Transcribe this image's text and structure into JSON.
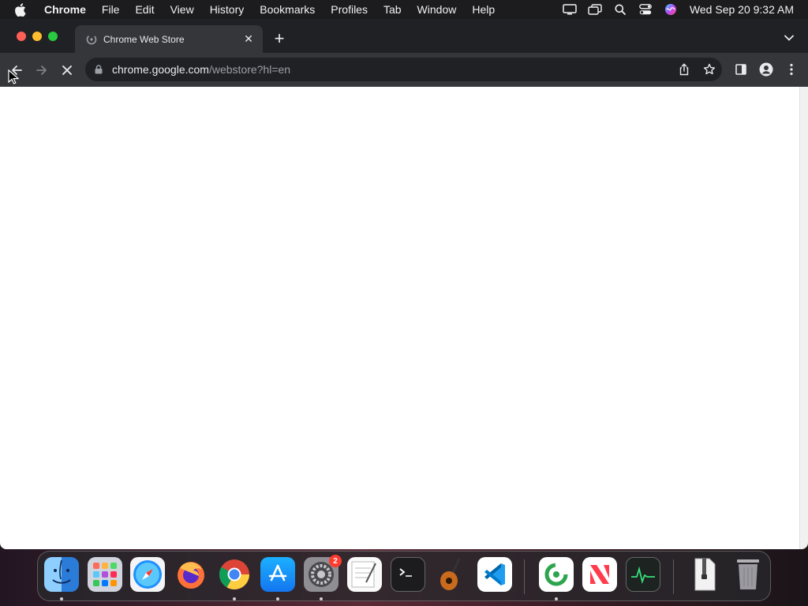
{
  "menubar": {
    "app_name": "Chrome",
    "items": [
      "File",
      "Edit",
      "View",
      "History",
      "Bookmarks",
      "Profiles",
      "Tab",
      "Window",
      "Help"
    ],
    "status_icons": [
      "display-icon",
      "screen-mirroring-icon",
      "spotlight-search-icon",
      "control-center-icon",
      "siri-icon"
    ],
    "clock": "Wed Sep 20  9:32 AM"
  },
  "browser": {
    "tab": {
      "title": "Chrome Web Store",
      "favicon": "chrome-web-store-icon",
      "close_glyph": "✕"
    },
    "new_tab_glyph": "+",
    "address": {
      "host": "chrome.google.com",
      "path": "/webstore?hl=en"
    },
    "loading": true
  },
  "dock": {
    "apps": [
      {
        "name": "Finder",
        "icon": "finder-icon",
        "running": true
      },
      {
        "name": "Launchpad",
        "icon": "launchpad-icon",
        "running": false
      },
      {
        "name": "Safari",
        "icon": "safari-icon",
        "running": false
      },
      {
        "name": "Firefox",
        "icon": "firefox-icon",
        "running": false
      },
      {
        "name": "Google Chrome",
        "icon": "chrome-icon",
        "running": true
      },
      {
        "name": "App Store",
        "icon": "app-store-icon",
        "running": true
      },
      {
        "name": "System Settings",
        "icon": "system-settings-icon",
        "running": true,
        "badge": "2"
      },
      {
        "name": "TextEdit",
        "icon": "textedit-icon",
        "running": false
      },
      {
        "name": "Terminal",
        "icon": "terminal-icon",
        "running": false
      },
      {
        "name": "GarageBand",
        "icon": "garageband-icon",
        "running": false
      },
      {
        "name": "Visual Studio Code",
        "icon": "vscode-icon",
        "running": false
      },
      {
        "name": "Grammarly",
        "icon": "grammarly-icon",
        "running": true
      },
      {
        "name": "News",
        "icon": "news-icon",
        "running": false
      },
      {
        "name": "Activity Monitor",
        "icon": "activity-monitor-icon",
        "running": false
      },
      {
        "name": "Archive",
        "icon": "zip-archive-icon",
        "running": false
      },
      {
        "name": "Trash",
        "icon": "trash-icon",
        "running": false
      }
    ],
    "badge_count": "2"
  },
  "colors": {
    "chrome_dark": "#202124",
    "toolbar": "#35363a",
    "page_bg": "#ffffff",
    "badge_red": "#ff3b30"
  }
}
